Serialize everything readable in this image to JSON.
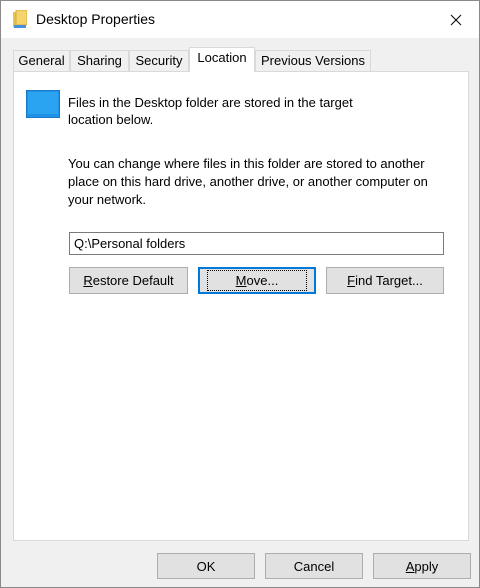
{
  "window": {
    "title": "Desktop Properties"
  },
  "tabs": [
    {
      "label": "General"
    },
    {
      "label": "Sharing"
    },
    {
      "label": "Security"
    },
    {
      "label": "Location"
    },
    {
      "label": "Previous Versions"
    }
  ],
  "active_tab": "Location",
  "location": {
    "description_line1": "Files in the Desktop folder are stored in the target",
    "description_line2": "location below.",
    "info_line1": "You can change where files in this folder are stored to another",
    "info_line2": "place on this hard drive, another drive, or another computer on",
    "info_line3": "your network.",
    "path_value": "Q:\\Personal folders",
    "restore_default": {
      "access_key": "R",
      "rest": "estore Default"
    },
    "move": {
      "access_key": "M",
      "rest": "ove..."
    },
    "find_target": {
      "access_key": "F",
      "rest": "ind Target..."
    }
  },
  "footer": {
    "ok_label": "OK",
    "cancel_label": "Cancel",
    "apply": {
      "access_key": "A",
      "rest": "pply"
    }
  },
  "icons": {
    "title": "folder-icon",
    "close": "close-icon",
    "folder": "desktop-folder-icon"
  },
  "colors": {
    "accent": "#0078d7",
    "desktop_icon": "#1e90e6"
  }
}
